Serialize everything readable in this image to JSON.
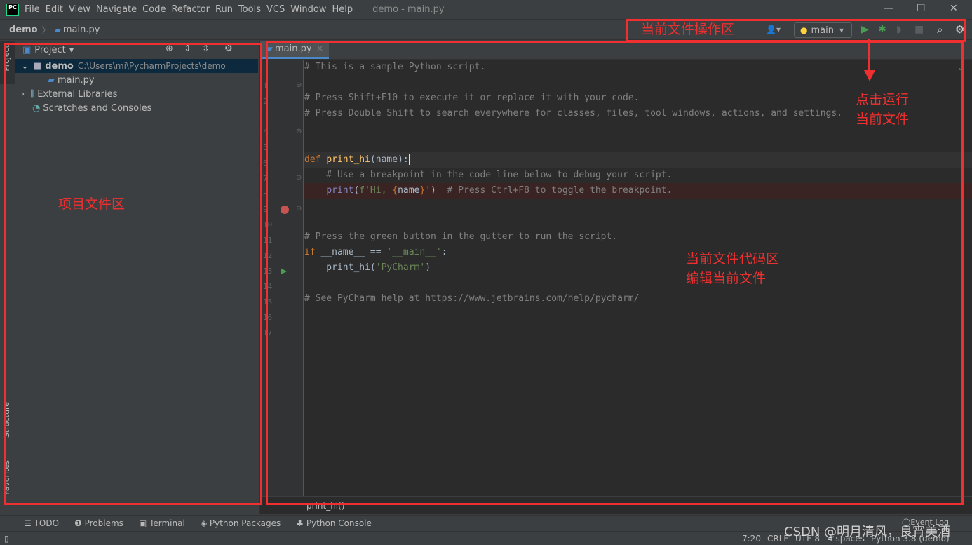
{
  "titlebar": {
    "logo": "PC",
    "menus": [
      "File",
      "Edit",
      "View",
      "Navigate",
      "Code",
      "Refactor",
      "Run",
      "Tools",
      "VCS",
      "Window",
      "Help"
    ],
    "title": "demo - main.py",
    "window_controls": [
      "minimize",
      "maximize",
      "close"
    ]
  },
  "navbar": {
    "project": "demo",
    "file": "main.py",
    "run_config": "main"
  },
  "side_tabs": {
    "project": "Project",
    "structure": "Structure",
    "favorites": "Favorites"
  },
  "project_panel": {
    "title": "Project",
    "tree": [
      {
        "label": "demo",
        "path": "C:\\Users\\mi\\PycharmProjects\\demo"
      },
      {
        "label": "main.py"
      },
      {
        "label": "External Libraries"
      },
      {
        "label": "Scratches and Consoles"
      }
    ]
  },
  "editor": {
    "tab": "main.py",
    "breadcrumb": "print_hi()",
    "breakpoint_line": 9,
    "run_gutter_line": 13,
    "lines": [
      [
        [
          "# This is a sample Python script.",
          "cm"
        ]
      ],
      [],
      [
        [
          "# Press Shift+F10 to execute it or replace it with your code.",
          "cm"
        ]
      ],
      [
        [
          "# Press Double Shift to search everywhere for classes, files, tool windows, actions, and settings.",
          "cm"
        ]
      ],
      [],
      [],
      [
        [
          "def ",
          "kw"
        ],
        [
          "print_hi",
          "fn"
        ],
        [
          "(name):",
          "tx"
        ]
      ],
      [
        [
          "    # Use a breakpoint in the code line below to debug your script.",
          "cm"
        ]
      ],
      [
        [
          "    ",
          "tx"
        ],
        [
          "print",
          "bi"
        ],
        [
          "(",
          "tx"
        ],
        [
          "f'Hi, ",
          "st"
        ],
        [
          "{",
          "kw"
        ],
        [
          "name",
          "tx"
        ],
        [
          "}",
          "kw"
        ],
        [
          "'",
          "st"
        ],
        [
          ")  ",
          "tx"
        ],
        [
          "# Press Ctrl+F8 to toggle the breakpoint.",
          "cm"
        ]
      ],
      [],
      [],
      [
        [
          "# Press the green button in the gutter to run the script.",
          "cm"
        ]
      ],
      [
        [
          "if ",
          "kw"
        ],
        [
          "__name__ == ",
          "tx"
        ],
        [
          "'__main__'",
          "st"
        ],
        [
          ":",
          "tx"
        ]
      ],
      [
        [
          "    print_hi(",
          "tx"
        ],
        [
          "'PyCharm'",
          "st"
        ],
        [
          ")",
          "tx"
        ]
      ],
      [],
      [
        [
          "# See PyCharm help at ",
          "cm"
        ],
        [
          "https://www.jetbrains.com/help/pycharm/",
          "ln"
        ]
      ],
      []
    ]
  },
  "tool_windows": [
    "TODO",
    "Problems",
    "Terminal",
    "Python Packages",
    "Python Console"
  ],
  "event_log": "Event Log",
  "status": {
    "position": "7:20",
    "line_sep": "CRLF",
    "encoding": "UTF-8",
    "indent": "4 spaces",
    "interpreter": "Python 3.8 (demo)"
  },
  "watermark": "CSDN @明月清风，良宵美酒",
  "annotations": {
    "toolbar": "当前文件操作区",
    "run_line1": "点击运行",
    "run_line2": "当前文件",
    "project": "项目文件区",
    "code_line1": "当前文件代码区",
    "code_line2": "编辑当前文件"
  },
  "colors": {
    "annotation": "#f03030",
    "run": "#499c54",
    "accent": "#4a88c7"
  }
}
